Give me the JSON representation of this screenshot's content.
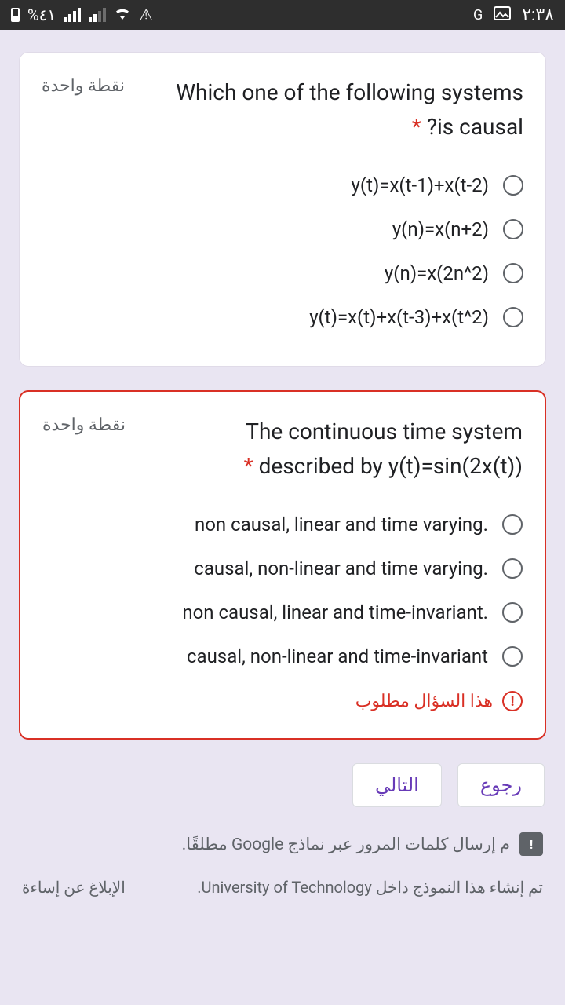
{
  "statusbar": {
    "battery_pct": "%٤١",
    "clock": "٢:٣٨"
  },
  "q1": {
    "points": "نقطة واحدة",
    "line1": "Which one of the following systems",
    "line2_prefix": "?is causal",
    "options": [
      "y(t)=x(t-1)+x(t-2)",
      "y(n)=x(n+2)",
      "y(n)=x(2n^2)",
      "y(t)=x(t)+x(t-3)+x(t^2)"
    ]
  },
  "q2": {
    "points": "نقطة واحدة",
    "line1": "The continuous time system",
    "line2": "described by y(t)=sin(2x(t))",
    "options": [
      "non causal, linear and time varying.",
      "causal, non-linear and time varying.",
      "non causal, linear and time-invariant.",
      "causal, non-linear and time-invariant"
    ],
    "required_msg": "هذا السؤال مطلوب"
  },
  "nav": {
    "back": "رجوع",
    "next": "التالي"
  },
  "warning": "م إرسال كلمات المرور عبر نماذج Google مطلقًا.",
  "footer": {
    "created": "تم إنشاء هذا النموذج داخل University of Technology.",
    "report": "الإبلاغ عن إساءة"
  }
}
